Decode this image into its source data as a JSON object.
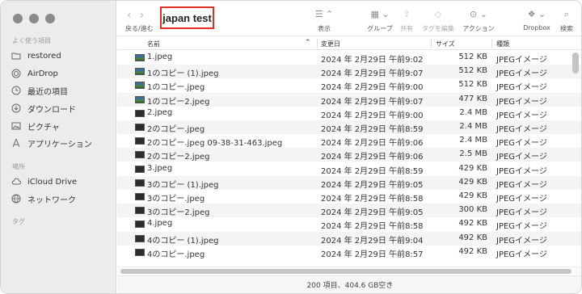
{
  "sidebar": {
    "favorites_label": "よく使う項目",
    "favorites": [
      {
        "label": "restored",
        "icon": "folder-icon"
      },
      {
        "label": "AirDrop",
        "icon": "airdrop-icon"
      },
      {
        "label": "最近の項目",
        "icon": "clock-icon"
      },
      {
        "label": "ダウンロード",
        "icon": "download-icon"
      },
      {
        "label": "ピクチャ",
        "icon": "photo-icon"
      },
      {
        "label": "アプリケーション",
        "icon": "applications-icon"
      }
    ],
    "locations_label": "場所",
    "locations": [
      {
        "label": "iCloud Drive",
        "icon": "cloud-icon"
      },
      {
        "label": "ネットワーク",
        "icon": "network-icon"
      }
    ],
    "tags_label": "タグ"
  },
  "toolbar": {
    "back_forward_label": "戻る/進む",
    "folder_title": "japan test",
    "view_label": "表示",
    "group_label": "グループ",
    "share_label": "共有",
    "tag_edit_label": "タグを編集",
    "action_label": "アクション",
    "dropbox_label": "Dropbox",
    "search_label": "検索"
  },
  "columns": {
    "name": "名前",
    "date": "変更日",
    "size": "サイズ",
    "kind": "種類"
  },
  "files": [
    {
      "name": "1.jpeg",
      "date": "2024 年 2月29日 午前9:02",
      "size": "512 KB",
      "kind": "JPEGイメージ",
      "thumb": "green"
    },
    {
      "name": "1のコピー (1).jpeg",
      "date": "2024 年 2月29日 午前9:07",
      "size": "512 KB",
      "kind": "JPEGイメージ",
      "thumb": "green"
    },
    {
      "name": "1のコピー.jpeg",
      "date": "2024 年 2月29日 午前9:00",
      "size": "512 KB",
      "kind": "JPEGイメージ",
      "thumb": "green"
    },
    {
      "name": "1のコピー2.jpeg",
      "date": "2024 年 2月29日 午前9:07",
      "size": "477 KB",
      "kind": "JPEGイメージ",
      "thumb": "green"
    },
    {
      "name": "2.jpeg",
      "date": "2024 年 2月29日 午前9:00",
      "size": "2.4 MB",
      "kind": "JPEGイメージ",
      "thumb": "dark"
    },
    {
      "name": "2のコピー.jpeg",
      "date": "2024 年 2月29日 午前8:59",
      "size": "2.4 MB",
      "kind": "JPEGイメージ",
      "thumb": "dark"
    },
    {
      "name": "2のコピー.jpeg 09-38-31-463.jpeg",
      "date": "2024 年 2月29日 午前9:06",
      "size": "2.4 MB",
      "kind": "JPEGイメージ",
      "thumb": "dark"
    },
    {
      "name": "2のコピー2.jpeg",
      "date": "2024 年 2月29日 午前9:06",
      "size": "2.5 MB",
      "kind": "JPEGイメージ",
      "thumb": "dark"
    },
    {
      "name": "3.jpeg",
      "date": "2024 年 2月29日 午前8:59",
      "size": "429 KB",
      "kind": "JPEGイメージ",
      "thumb": "dark"
    },
    {
      "name": "3のコピー (1).jpeg",
      "date": "2024 年 2月29日 午前9:05",
      "size": "429 KB",
      "kind": "JPEGイメージ",
      "thumb": "dark"
    },
    {
      "name": "3のコピー.jpeg",
      "date": "2024 年 2月29日 午前8:58",
      "size": "429 KB",
      "kind": "JPEGイメージ",
      "thumb": "dark"
    },
    {
      "name": "3のコピー2.jpeg",
      "date": "2024 年 2月29日 午前9:05",
      "size": "300 KB",
      "kind": "JPEGイメージ",
      "thumb": "dark"
    },
    {
      "name": "4.jpeg",
      "date": "2024 年 2月29日 午前8:58",
      "size": "492 KB",
      "kind": "JPEGイメージ",
      "thumb": "dark"
    },
    {
      "name": "4のコピー (1).jpeg",
      "date": "2024 年 2月29日 午前9:04",
      "size": "492 KB",
      "kind": "JPEGイメージ",
      "thumb": "dark"
    },
    {
      "name": "4のコピー.jpeg",
      "date": "2024 年 2月29日 午前8:57",
      "size": "492 KB",
      "kind": "JPEGイメージ",
      "thumb": "dark"
    }
  ],
  "status": {
    "summary": "200 項目、404.6 GB空き"
  },
  "colors": {
    "title_highlight": "#e03020",
    "sidebar_bg": "#ececec",
    "row_alt_bg": "#f4f4f4"
  }
}
